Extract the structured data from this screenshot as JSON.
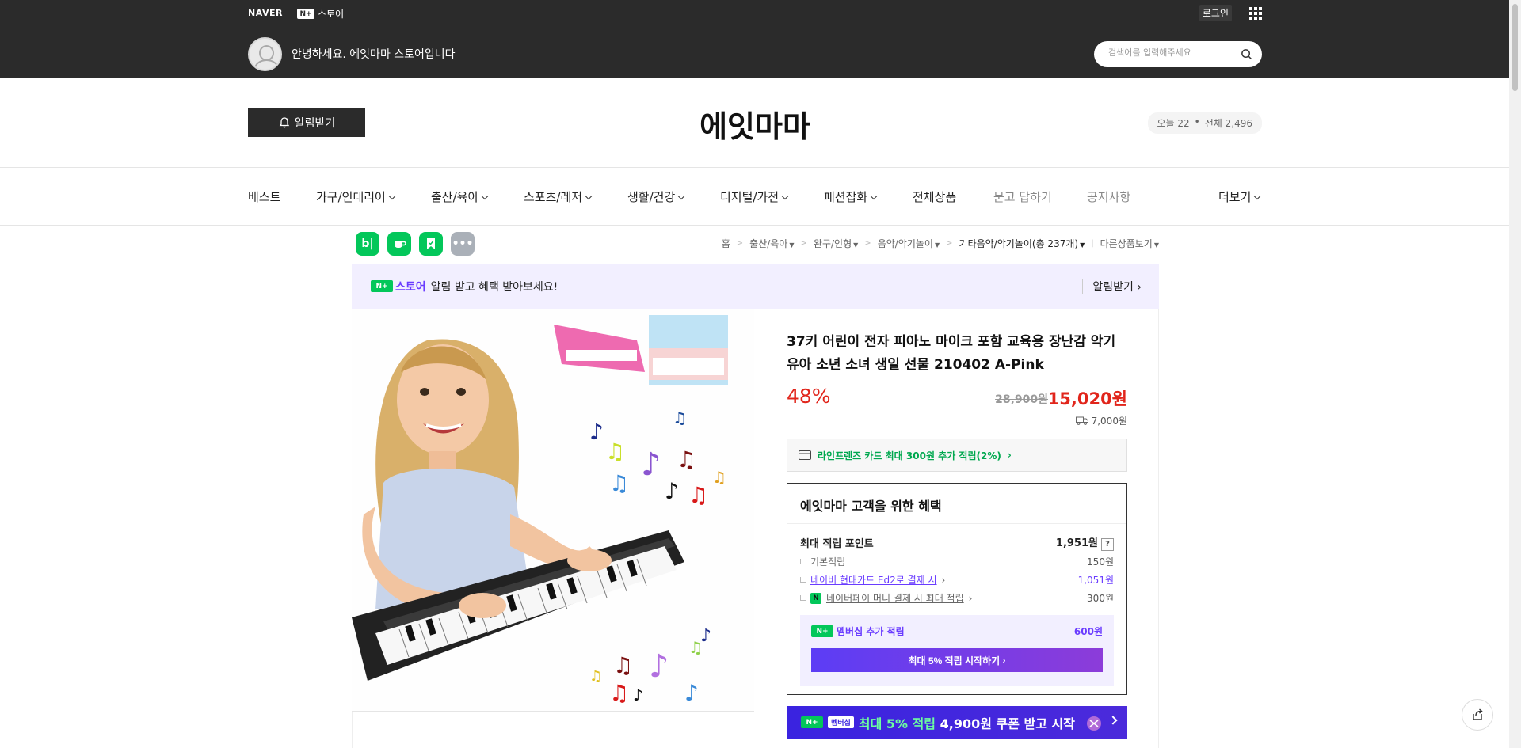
{
  "topbar": {
    "naver_logo": "NAVER",
    "nplus_icon_text": "N+",
    "nplus_store_label": "스토어",
    "login_label": "로그인",
    "greeting": "안녕하세요. 에잇마마 스토어입니다",
    "search_placeholder": "검색어를 입력해주세요"
  },
  "header": {
    "alarm_button": "알림받기",
    "store_name": "에잇마마",
    "visitor_today": "오늘 22",
    "visitor_total": "전체 2,496"
  },
  "nav": {
    "items": [
      {
        "label": "베스트"
      },
      {
        "label": "가구/인테리어"
      },
      {
        "label": "출산/육아"
      },
      {
        "label": "스포츠/레저"
      },
      {
        "label": "생활/건강"
      },
      {
        "label": "디지털/가전"
      },
      {
        "label": "패션잡화"
      },
      {
        "label": "전체상품"
      },
      {
        "label": "묻고 답하기"
      },
      {
        "label": "공지사항"
      },
      {
        "label": "더보기"
      }
    ]
  },
  "breadcrumb": {
    "items": [
      "홈",
      "출산/육아",
      "완구/인형",
      "음악/악기놀이",
      "기타음악/악기놀이(총 237개)",
      "다른상품보기"
    ]
  },
  "share_icons": [
    "blog-icon",
    "cafe-icon",
    "bookmark-icon",
    "more-icon"
  ],
  "banner": {
    "store_label": "스토어",
    "message": "알림 받고 혜택 받아보세요!",
    "action": "알림받기"
  },
  "product": {
    "title": "37키 어린이 전자 피아노 마이크 포함 교육용 장난감 악기 유아 소년 소녀 생일 선물 210402 A-Pink",
    "discount": "48%",
    "original_price": "28,900원",
    "price": "15,020원",
    "shipping": "7,000원",
    "card_promo": "라인프렌즈 카드 최대 300원 추가 적립(2%)"
  },
  "benefit": {
    "title": "에잇마마 고객을 위한 혜택",
    "max_points_label": "최대 적립 포인트",
    "max_points_value": "1,951원",
    "question": "?",
    "basic_label": "기본적립",
    "basic_value": "150원",
    "card_label": "네이버 현대카드 Ed2로 결제 시",
    "card_value": "1,051원",
    "npay_icon": "N",
    "npay_label": "네이버페이 머니 결제 시 최대 적립",
    "npay_value": "300원",
    "membership_label": "멤버십 추가 적립",
    "membership_value": "600원",
    "membership_button": "최대 5% 적립 시작하기"
  },
  "coupon": {
    "tag": "N+",
    "tag2": "멤버십",
    "text_prefix": "최대 5% 적립",
    "text_suffix": "4,900원 쿠폰 받고 시작"
  },
  "colors": {
    "topbar_bg": "#2b2b2b",
    "sale_red": "#e1251b",
    "naver_green": "#03c75a",
    "membership_purple": "#6a3cff"
  }
}
